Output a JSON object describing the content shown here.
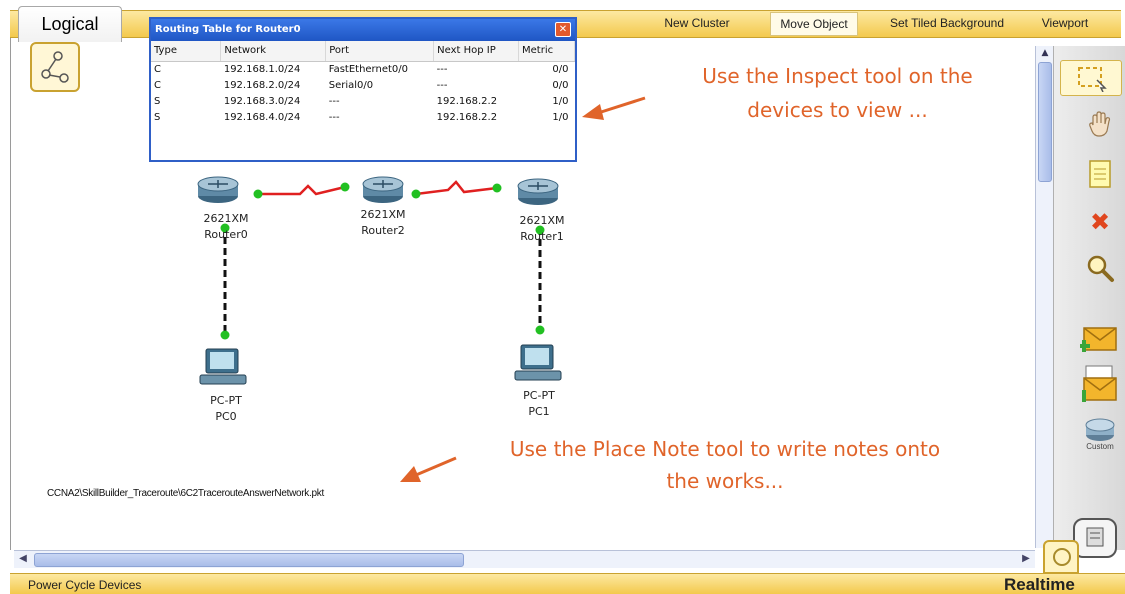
{
  "workspace": {
    "mode_tab": "Logical"
  },
  "toolbar": {
    "new_cluster": "New Cluster",
    "move_object": "Move Object",
    "set_tiled_background": "Set Tiled Background",
    "viewport": "Viewport"
  },
  "routing_window": {
    "title": "Routing Table for Router0",
    "close_glyph": "✕",
    "headers": [
      "Type",
      "Network",
      "Port",
      "Next Hop IP",
      "Metric"
    ],
    "rows": [
      [
        "C",
        "192.168.1.0/24",
        "FastEthernet0/0",
        "---",
        "0/0"
      ],
      [
        "C",
        "192.168.2.0/24",
        "Serial0/0",
        "---",
        "0/0"
      ],
      [
        "S",
        "192.168.3.0/24",
        "---",
        "192.168.2.2",
        "1/0"
      ],
      [
        "S",
        "192.168.4.0/24",
        "---",
        "192.168.2.2",
        "1/0"
      ]
    ]
  },
  "annotations": {
    "inspect_line1": "Use the Inspect tool on the",
    "inspect_line2": "devices to view ...",
    "note_line1": "Use the Place Note tool to write notes onto",
    "note_line2": "the works...",
    "file_name": "CCNA2\\SkillBuilder_Traceroute\\6C2TracerouteAnswerNetwork.pkt"
  },
  "devices": {
    "router0": {
      "model": "2621XM",
      "name": "Router0"
    },
    "router2": {
      "model": "2621XM",
      "name": "Router2"
    },
    "router1": {
      "model": "2621XM",
      "name": "Router1"
    },
    "pc0": {
      "model": "PC-PT",
      "name": "PC0"
    },
    "pc1": {
      "model": "PC-PT",
      "name": "PC1"
    }
  },
  "right_panel": {
    "selected_tool": "select-tool",
    "tools": [
      "select-icon",
      "move-hand-icon",
      "note-icon",
      "delete-icon",
      "inspect-magnifier-icon",
      "add-simple-pdu-icon",
      "add-complex-pdu-icon",
      "custom-device-icon"
    ],
    "custom_label": "Custom"
  },
  "statusbar": {
    "left_text": "Power Cycle Devices",
    "mode": "Realtime"
  },
  "colors": {
    "accent_yellow": "#f3c94d",
    "annotation_orange": "#e0642a",
    "link_red": "#e02020",
    "port_green": "#22c022",
    "window_blue": "#1f56c4"
  }
}
